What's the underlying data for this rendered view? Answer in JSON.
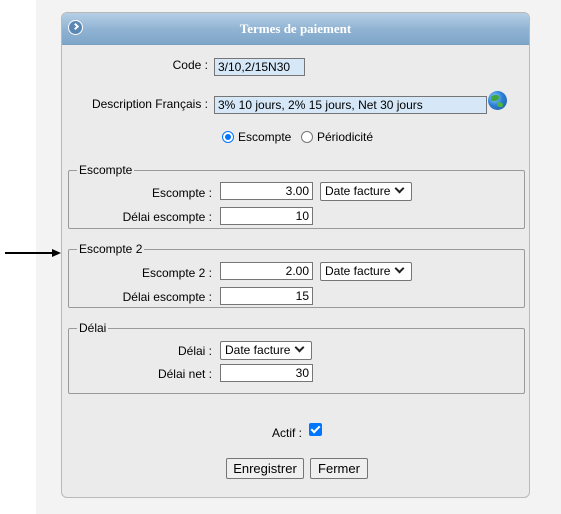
{
  "window": {
    "title": "Termes de paiement"
  },
  "form": {
    "code_label": "Code :",
    "code_value": "3/10,2/15N30",
    "description_label": "Description Français :",
    "description_value": "3% 10 jours, 2% 15 jours, Net 30 jours",
    "mode_options": [
      "Escompte",
      "Périodicité"
    ],
    "mode_selected": "Escompte"
  },
  "escompte": {
    "legend": "Escompte",
    "escompte_label": "Escompte :",
    "escompte_value": "3.00",
    "base_select": "Date facture",
    "delai_label": "Délai escompte :",
    "delai_value": "10"
  },
  "escompte2": {
    "legend": "Escompte 2",
    "escompte_label": "Escompte 2 :",
    "escompte_value": "2.00",
    "base_select": "Date facture",
    "delai_label": "Délai escompte :",
    "delai_value": "15"
  },
  "delai": {
    "legend": "Délai",
    "delai_label": "Délai :",
    "delai_select": "Date facture",
    "net_label": "Délai net :",
    "net_value": "30"
  },
  "actif": {
    "label": "Actif :",
    "checked": true
  },
  "buttons": {
    "save": "Enregistrer",
    "close": "Fermer"
  },
  "colors": {
    "header": "#8fb2d2",
    "accent": "#0075ff",
    "highlight_input": "#d6e8f8"
  }
}
